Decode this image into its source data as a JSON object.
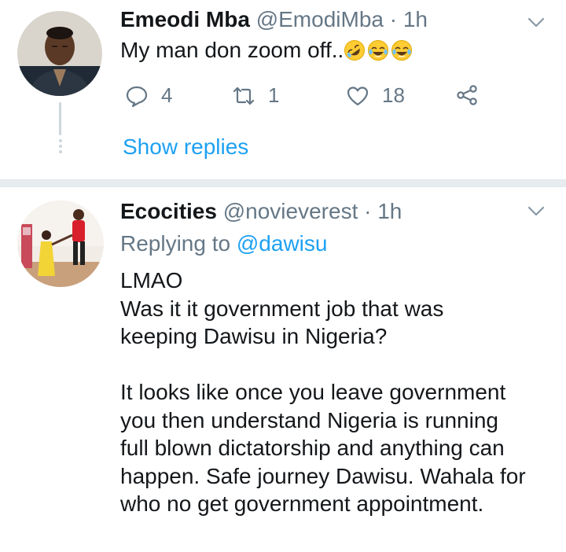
{
  "tweets": [
    {
      "name": "Emeodi Mba",
      "handle": "@EmodiMba",
      "time": "1h",
      "text": "My man don zoom off..",
      "emoji_icons": [
        "rolling-on-floor-laughing-emoji",
        "tears-of-joy-emoji",
        "tears-of-joy-emoji"
      ],
      "actions": {
        "replies": "4",
        "retweets": "1",
        "likes": "18"
      },
      "show_replies_label": "Show replies"
    },
    {
      "name": "Ecocities",
      "handle": "@novieverest",
      "time": "1h",
      "replying_prefix": "Replying to",
      "replying_to": "@dawisu",
      "text": "LMAO\nWas it it government job that was\nkeeping Dawisu in Nigeria?\n\nIt looks like once you leave government\nyou then understand Nigeria is running\nfull blown dictatorship and anything can\nhappen. Safe journey Dawisu. Wahala for\nwho no get government appointment."
    }
  ],
  "colors": {
    "accent": "#1da1f2",
    "secondary_text": "#657786",
    "primary_text": "#14171a",
    "divider": "#e6ecf0"
  }
}
